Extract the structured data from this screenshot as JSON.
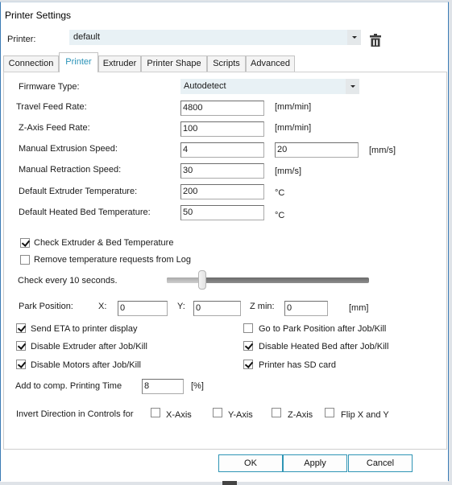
{
  "window": {
    "title": "Printer Settings"
  },
  "printer": {
    "label": "Printer:",
    "value": "default",
    "delete_icon": "trash-icon"
  },
  "tabs": [
    {
      "label": "Connection",
      "active": false
    },
    {
      "label": "Printer",
      "active": true
    },
    {
      "label": "Extruder",
      "active": false
    },
    {
      "label": "Printer Shape",
      "active": false
    },
    {
      "label": "Scripts",
      "active": false
    },
    {
      "label": "Advanced",
      "active": false
    }
  ],
  "form": {
    "firmware": {
      "label": "Firmware Type:",
      "value": "Autodetect"
    },
    "travel_feed": {
      "label": "Travel Feed Rate:",
      "value": "4800",
      "unit": "[mm/min]"
    },
    "z_feed": {
      "label": "Z-Axis Feed Rate:",
      "value": "100",
      "unit": "[mm/min]"
    },
    "manual_extrusion": {
      "label": "Manual Extrusion Speed:",
      "value_min": "4",
      "value_max": "20",
      "unit": "[mm/s]"
    },
    "manual_retraction": {
      "label": "Manual Retraction Speed:",
      "value": "30",
      "unit": "[mm/s]"
    },
    "extruder_temp": {
      "label": "Default Extruder Temperature:",
      "value": "200",
      "unit": "°C"
    },
    "bed_temp": {
      "label": "Default Heated Bed Temperature:",
      "value": "50",
      "unit": "°C"
    }
  },
  "temperature": {
    "check_temp": {
      "label": "Check Extruder & Bed Temperature",
      "checked": true
    },
    "remove_requests": {
      "label": "Remove temperature requests from Log",
      "checked": false
    },
    "check_every": {
      "label": "Check every 10 seconds.",
      "seconds": 10,
      "slider_fraction": 0.16
    }
  },
  "park": {
    "label": "Park Position:",
    "x_label": "X:",
    "x_value": "0",
    "y_label": "Y:",
    "y_value": "0",
    "z_label": "Z min:",
    "z_value": "0",
    "unit": "[mm]"
  },
  "options_left": [
    {
      "label": "Send ETA to printer display",
      "checked": true
    },
    {
      "label": "Disable Extruder after Job/Kill",
      "checked": true
    },
    {
      "label": "Disable Motors after Job/Kill",
      "checked": true
    }
  ],
  "options_right": [
    {
      "label": "Go to Park Position after Job/Kill",
      "checked": false
    },
    {
      "label": "Disable Heated Bed after Job/Kill",
      "checked": true
    },
    {
      "label": "Printer has SD card",
      "checked": true
    }
  ],
  "printing_time": {
    "label": "Add to comp. Printing Time",
    "value": "8",
    "unit": "[%]"
  },
  "invert": {
    "label": "Invert Direction in Controls for",
    "options": [
      {
        "label": "X-Axis",
        "checked": false
      },
      {
        "label": "Y-Axis",
        "checked": false
      },
      {
        "label": "Z-Axis",
        "checked": false
      },
      {
        "label": "Flip X and Y",
        "checked": false
      }
    ]
  },
  "buttons": {
    "ok": "OK",
    "apply": "Apply",
    "cancel": "Cancel"
  }
}
